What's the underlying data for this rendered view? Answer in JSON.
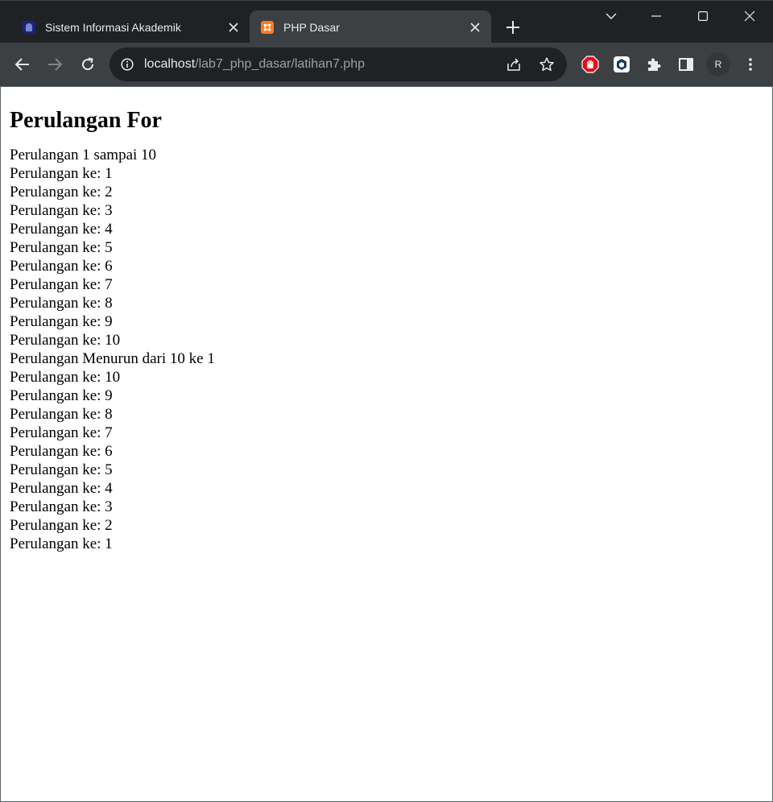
{
  "browser": {
    "tabs": [
      {
        "title": "Sistem Informasi Akademik",
        "favicon": "siakad-logo",
        "active": false
      },
      {
        "title": "PHP Dasar",
        "favicon": "xampp-logo",
        "active": true
      }
    ],
    "address": {
      "host": "localhost",
      "path": "/lab7_php_dasar/latihan7.php"
    },
    "profile_initial": "R",
    "colors": {
      "tabstrip": "#202124",
      "toolbar": "#3c4043",
      "omnibox": "#202124",
      "xampp_orange": "#fb7a24",
      "adblock_red": "#e0101a"
    }
  },
  "page": {
    "heading": "Perulangan For",
    "lines": [
      "Perulangan 1 sampai 10",
      "Perulangan ke: 1",
      "Perulangan ke: 2",
      "Perulangan ke: 3",
      "Perulangan ke: 4",
      "Perulangan ke: 5",
      "Perulangan ke: 6",
      "Perulangan ke: 7",
      "Perulangan ke: 8",
      "Perulangan ke: 9",
      "Perulangan ke: 10",
      "Perulangan Menurun dari 10 ke 1",
      "Perulangan ke: 10",
      "Perulangan ke: 9",
      "Perulangan ke: 8",
      "Perulangan ke: 7",
      "Perulangan ke: 6",
      "Perulangan ke: 5",
      "Perulangan ke: 4",
      "Perulangan ke: 3",
      "Perulangan ke: 2",
      "Perulangan ke: 1"
    ]
  }
}
